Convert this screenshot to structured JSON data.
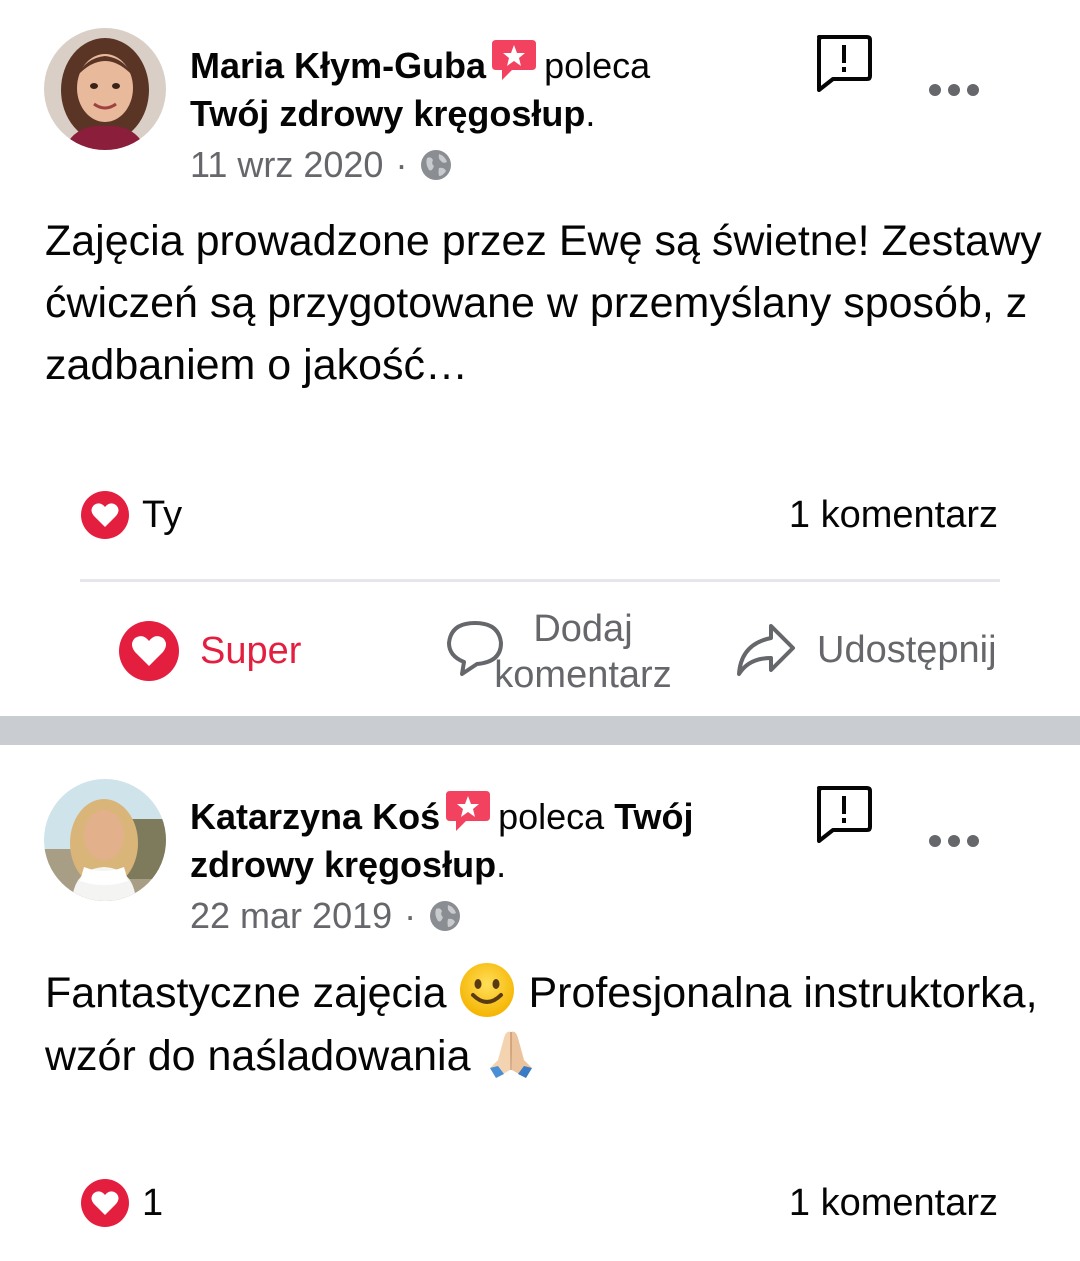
{
  "posts": [
    {
      "author": "Maria Kłym-Guba",
      "verb": "poleca",
      "page": "Twój zdrowy kręgosłup",
      "date": "11 wrz 2020",
      "text": "Zajęcia prowadzone przez Ewę są świetne! Zestawy ćwiczeń są przygotowane w przemyślany sposób, z zadbaniem o jakość…",
      "reactions_label": "Ty",
      "comments_label": "1 komentarz",
      "avatar_color": "#7a4a3a"
    },
    {
      "author": "Katarzyna Koś",
      "verb": "poleca",
      "page": "Twój zdrowy kręgosłup",
      "date": "22 mar 2019",
      "text_before_emoji": "Fantastyczne zajęcia",
      "text_middle": "Profesjonalna instruktorka, wzór do naśladowania",
      "reactions_label": "1",
      "comments_label": "1 komentarz",
      "avatar_color": "#c9a27a"
    }
  ],
  "actions": {
    "like_label": "Super",
    "comment_label_line1": "Dodaj",
    "comment_label_line2": "komentarz",
    "share_label": "Udostępnij"
  },
  "icons": {
    "recommend": "recommend-badge-icon",
    "privacy": "globe-icon",
    "report": "report-icon",
    "more": "more-options-icon",
    "love": "love-reaction-icon",
    "comment": "comment-bubble-icon",
    "share": "share-arrow-icon",
    "smile": "smiley-emoji-icon",
    "pray": "folded-hands-emoji-icon"
  },
  "colors": {
    "accent_red": "#e41e3f",
    "secondary_text": "#65676b",
    "separator": "#c9ccd1",
    "divider": "#e4e6eb"
  }
}
